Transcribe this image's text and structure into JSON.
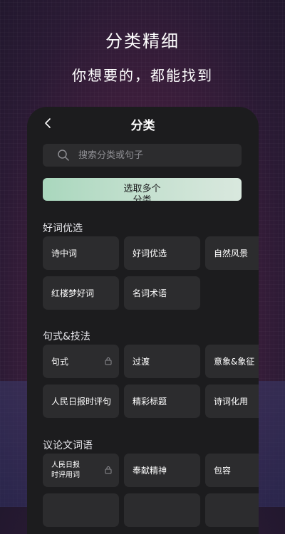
{
  "promo": {
    "headline": "分类精细",
    "subline": "你想要的，都能找到"
  },
  "header": {
    "title": "分类"
  },
  "search": {
    "placeholder": "搜索分类或句子"
  },
  "multi_select_label": "选取多个分类",
  "sections": [
    {
      "title": "好词优选",
      "items": [
        {
          "label": "诗中词",
          "locked": false
        },
        {
          "label": "好词优选",
          "locked": false
        },
        {
          "label": "自然风景",
          "locked": false
        },
        {
          "label": "红楼梦好词",
          "locked": false
        },
        {
          "label": "名词术语",
          "locked": false
        }
      ]
    },
    {
      "title": "句式&技法",
      "items": [
        {
          "label": "句式",
          "locked": true
        },
        {
          "label": "过渡",
          "locked": false
        },
        {
          "label": "意象&象征",
          "locked": false
        },
        {
          "label": "人民日报时评句",
          "locked": false
        },
        {
          "label": "精彩标题",
          "locked": false
        },
        {
          "label": "诗词化用",
          "locked": false
        }
      ]
    },
    {
      "title": "议论文词语",
      "items": [
        {
          "label": "人民日报时评用词",
          "locked": true
        },
        {
          "label": "奉献精神",
          "locked": false
        },
        {
          "label": "包容",
          "locked": false
        }
      ]
    }
  ],
  "colors": {
    "panel": "#1c1c1e",
    "tile": "#2c2c2e",
    "accent_start": "#a9d7bd",
    "accent_end": "#d9e8de"
  }
}
